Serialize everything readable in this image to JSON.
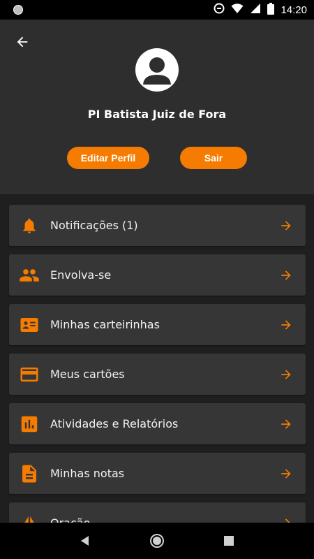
{
  "status_bar": {
    "time": "14:20",
    "icons": [
      "circle-icon",
      "data-saver-icon",
      "wifi-icon",
      "signal-icon",
      "battery-icon"
    ]
  },
  "header": {
    "back_icon": "arrow-back-icon",
    "avatar_icon": "person-icon",
    "profile_name": "PI Batista Juiz de Fora",
    "edit_label": "Editar Perfil",
    "exit_label": "Sair"
  },
  "menu": {
    "items": [
      {
        "label": "Notificações (1)",
        "icon": "bell-icon"
      },
      {
        "label": "Envolva-se",
        "icon": "people-icon"
      },
      {
        "label": "Minhas carteirinhas",
        "icon": "id-card-icon"
      },
      {
        "label": "Meus cartões",
        "icon": "credit-card-icon"
      },
      {
        "label": "Atividades e Relatórios",
        "icon": "bar-chart-icon"
      },
      {
        "label": "Minhas notas",
        "icon": "document-icon"
      },
      {
        "label": "Oração",
        "icon": "praying-hands-icon"
      }
    ]
  },
  "nav_bar": {
    "icons": [
      "back-triangle-icon",
      "home-circle-icon",
      "recents-square-icon"
    ]
  },
  "colors": {
    "accent": "#f57c00",
    "header_bg": "#2e2e2e",
    "page_bg": "#1f1f1f",
    "card_bg": "#363636"
  }
}
